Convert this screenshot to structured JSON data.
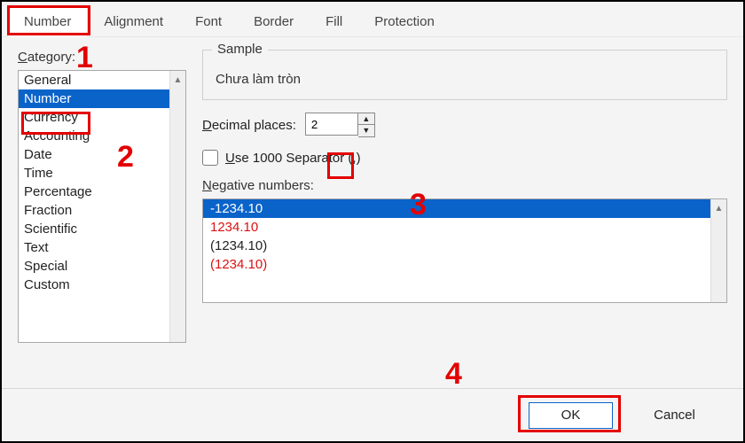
{
  "tabs": {
    "items": [
      {
        "label": "Number",
        "active": true
      },
      {
        "label": "Alignment"
      },
      {
        "label": "Font"
      },
      {
        "label": "Border"
      },
      {
        "label": "Fill"
      },
      {
        "label": "Protection"
      }
    ]
  },
  "category": {
    "label": "Category:",
    "items": [
      "General",
      "Number",
      "Currency",
      "Accounting",
      "Date",
      "Time",
      "Percentage",
      "Fraction",
      "Scientific",
      "Text",
      "Special",
      "Custom"
    ],
    "selected_index": 1
  },
  "sample": {
    "legend": "Sample",
    "value": "Chưa làm tròn"
  },
  "decimal": {
    "label": "Decimal places:",
    "value": "2"
  },
  "separator": {
    "label": "Use 1000 Separator (,)",
    "checked": false
  },
  "negative": {
    "label": "Negative numbers:",
    "items": [
      {
        "text": "-1234.10",
        "red": false,
        "selected": true
      },
      {
        "text": "1234.10",
        "red": true
      },
      {
        "text": "(1234.10)",
        "red": false
      },
      {
        "text": "(1234.10)",
        "red": true
      }
    ]
  },
  "buttons": {
    "ok": "OK",
    "cancel": "Cancel"
  },
  "annotations": {
    "n1": "1",
    "n2": "2",
    "n3": "3",
    "n4": "4"
  }
}
